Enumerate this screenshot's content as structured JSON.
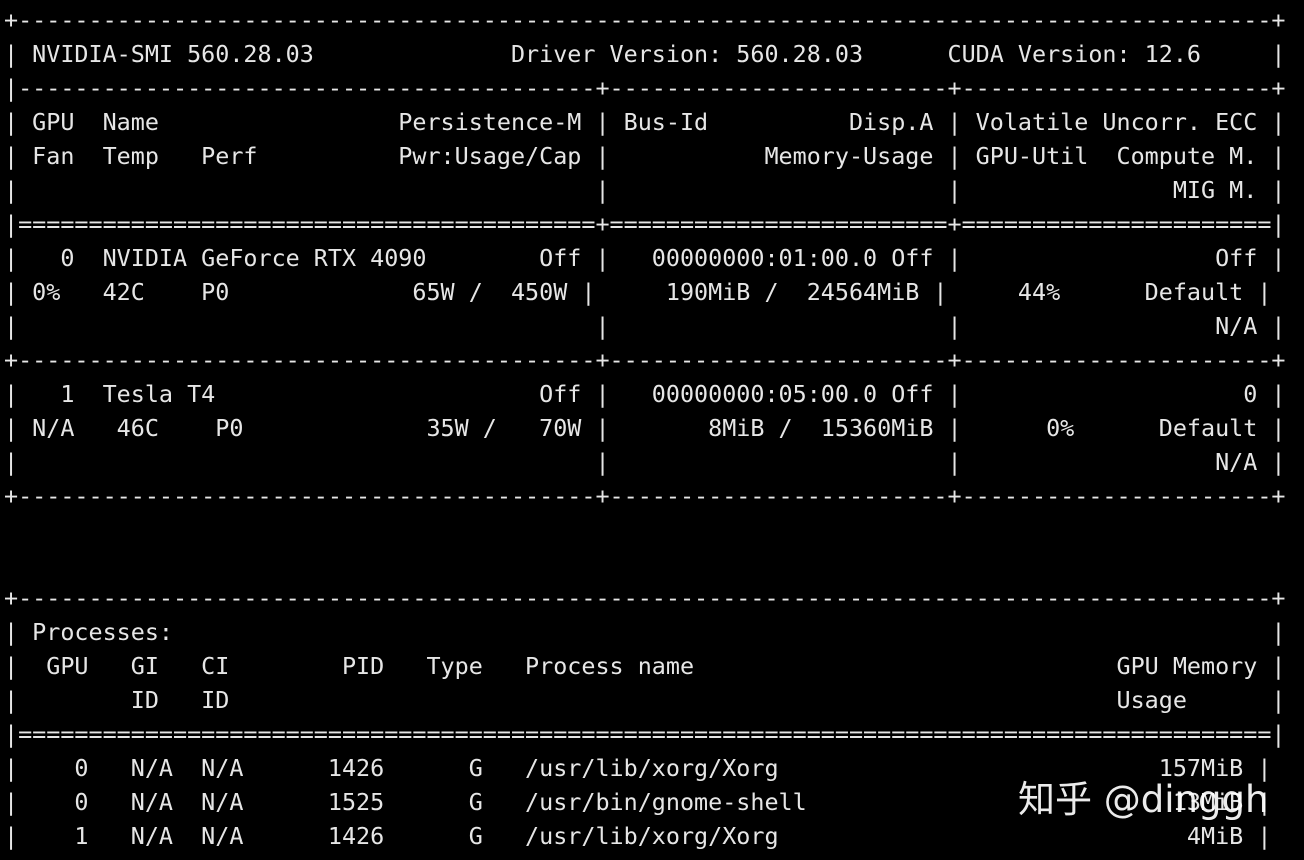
{
  "terminal": {
    "background": "#000000",
    "foreground": "#e6e6e6",
    "lines": [
      "+-----------------------------------------------------------------------------------------+",
      "| NVIDIA-SMI 560.28.03              Driver Version: 560.28.03      CUDA Version: 12.6     |",
      "|-----------------------------------------+------------------------+----------------------+",
      "| GPU  Name                 Persistence-M | Bus-Id          Disp.A | Volatile Uncorr. ECC |",
      "| Fan  Temp   Perf          Pwr:Usage/Cap |           Memory-Usage | GPU-Util  Compute M. |",
      "|                                         |                        |               MIG M. |",
      "|=========================================+========================+======================|",
      "|   0  NVIDIA GeForce RTX 4090        Off |   00000000:01:00.0 Off |                  Off |",
      "| 0%   42C    P0             65W /  450W |     190MiB /  24564MiB |     44%      Default |",
      "|                                         |                        |                  N/A |",
      "+-----------------------------------------+------------------------+----------------------+",
      "|   1  Tesla T4                       Off |   00000000:05:00.0 Off |                    0 |",
      "| N/A   46C    P0             35W /   70W |       8MiB /  15360MiB |      0%      Default |",
      "|                                         |                        |                  N/A |",
      "+-----------------------------------------+------------------------+----------------------+",
      "",
      "",
      "+-----------------------------------------------------------------------------------------+",
      "| Processes:                                                                              |",
      "|  GPU   GI   CI        PID   Type   Process name                              GPU Memory |",
      "|        ID   ID                                                               Usage      |",
      "|=========================================================================================|",
      "|    0   N/A  N/A      1426      G   /usr/lib/xorg/Xorg                           157MiB |",
      "|    0   N/A  N/A      1525      G   /usr/bin/gnome-shell                          13MiB |",
      "|    1   N/A  N/A      1426      G   /usr/lib/xorg/Xorg                             4MiB |",
      "+-----------------------------------------------------------------------------------------+"
    ]
  },
  "watermark": {
    "text": "知乎 @dinggh"
  }
}
